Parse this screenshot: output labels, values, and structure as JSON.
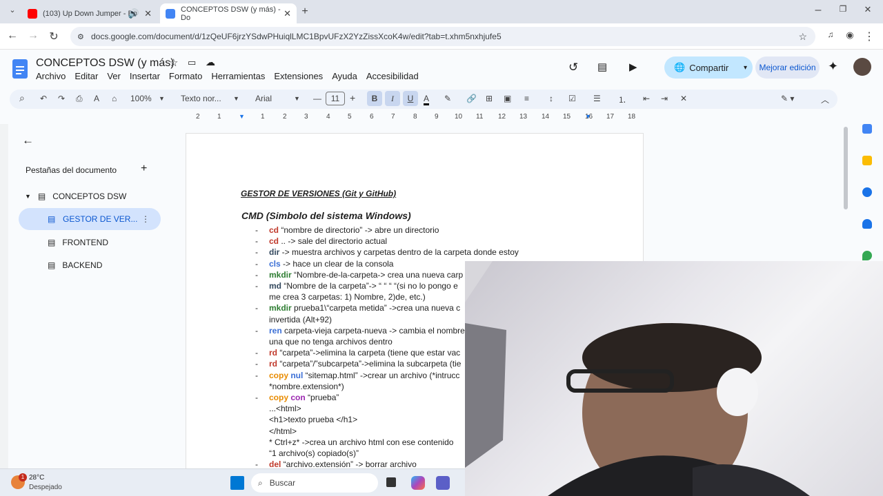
{
  "browser": {
    "tabs": [
      {
        "title": "(103) Up Down Jumper - Bo",
        "color": "#ff0000"
      },
      {
        "title": "CONCEPTOS DSW (y más) - Do",
        "color": "#4285f4"
      }
    ],
    "url": "docs.google.com/document/d/1zQeUF6jrzYSdwPHuiqlLMC1BpvUFzX2YzZissXcoK4w/edit?tab=t.xhm5nxhjufe5"
  },
  "doc": {
    "title": "CONCEPTOS DSW (y más)",
    "menu": [
      "Archivo",
      "Editar",
      "Ver",
      "Insertar",
      "Formato",
      "Herramientas",
      "Extensiones",
      "Ayuda",
      "Accesibilidad"
    ],
    "share_label": "Compartir",
    "improve_label": "Mejorar edición"
  },
  "toolbar": {
    "zoom": "100%",
    "style": "Texto nor...",
    "font": "Arial",
    "size": "11"
  },
  "ruler": [
    "2",
    "1",
    "1",
    "2",
    "3",
    "4",
    "5",
    "6",
    "7",
    "8",
    "9",
    "10",
    "11",
    "12",
    "13",
    "14",
    "15",
    "16",
    "17",
    "18"
  ],
  "sidebar": {
    "heading": "Pestañas del documento",
    "tab_root": "CONCEPTOS DSW",
    "items": [
      "GESTOR DE VER...",
      "FRONTEND",
      "BACKEND"
    ]
  },
  "content": {
    "title": "GESTOR DE VERSIONES (Git y GitHub)",
    "subtitle": "CMD (Simbolo del sistema Windows)",
    "lines": [
      {
        "cmd": "cd",
        "text": " “nombre de directorio” -> abre un directorio"
      },
      {
        "cmd": "cd",
        "text": " .. -> sale del directorio actual"
      },
      {
        "cmd": "dir",
        "text": " -> muestra archivos y carpetas dentro de la carpeta donde estoy"
      },
      {
        "cmd": "cls",
        "text": " -> hace un clear de la consola"
      },
      {
        "cmd": "mkdir",
        "text": " “Nombre-de-la-carpeta-> crea una nueva carp"
      },
      {
        "cmd": "md",
        "text": " “Nombre de la carpeta”-> “ “ “ “(si no lo pongo e"
      },
      {
        "cmd": "",
        "text": "me crea 3 carpetas: 1) Nombre, 2)de, etc.)"
      },
      {
        "cmd": "mkdir",
        "text": " prueba1\\“carpeta metida” ->crea una nueva c"
      },
      {
        "cmd": "",
        "text": "invertida (Alt+92)"
      },
      {
        "cmd": "ren",
        "text": " carpeta-vieja carpeta-nueva -> cambia el nombre"
      },
      {
        "cmd": "",
        "text": "una que no tenga archivos dentro"
      },
      {
        "cmd": "rd",
        "text": " “carpeta”->elimina la carpeta (tiene que estar vac"
      },
      {
        "cmd": "rd",
        "text": " “carpeta”/”subcarpeta”->elimina la subcarpeta (tie"
      },
      {
        "cmd": "copy nul",
        "text": " “sitemap.html” ->crear un archivo (*intrucc"
      },
      {
        "cmd": "",
        "text": "*nombre.extension*)"
      },
      {
        "cmd": "copy con",
        "text": " “prueba”"
      },
      {
        "cmd": "",
        "text": "...<html>"
      },
      {
        "cmd": "",
        "text": "<h1>texto prueba </h1>"
      },
      {
        "cmd": "",
        "text": "</html>"
      },
      {
        "cmd": "",
        "text": "* Ctrl+z*    ->crea un archivo html con ese contenido"
      },
      {
        "cmd": "",
        "text": "“1 archivo(s) copiado(s)”"
      },
      {
        "cmd": "del",
        "text": " “archivo.extensión” -> borrar archivo"
      }
    ]
  },
  "taskbar": {
    "weather_temp": "28°C",
    "weather_desc": "Despejado",
    "search_placeholder": "Buscar"
  }
}
